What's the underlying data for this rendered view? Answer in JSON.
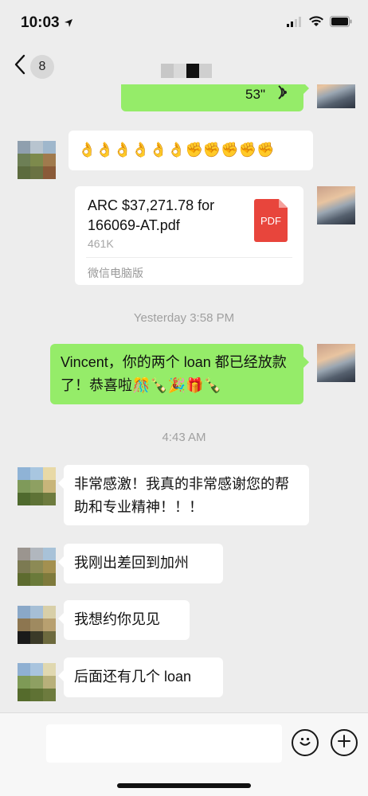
{
  "status_bar": {
    "time": "10:03",
    "location_icon": "location-arrow-icon",
    "signal_icon": "cellular-signal-icon",
    "wifi_icon": "wifi-icon",
    "battery_icon": "battery-icon"
  },
  "nav": {
    "back_icon": "chevron-left-icon",
    "unread_count": "8"
  },
  "messages": {
    "voice": {
      "duration": "53\"",
      "icon": "voice-wave-icon"
    },
    "emoji_row": {
      "text": "👌👌👌👌👌👌✊✊✊✊✊"
    },
    "file": {
      "name": "ARC $37,271.78 for 166069-AT.pdf",
      "size": "461K",
      "source": "微信电脑版",
      "badge": "PDF"
    },
    "time1": "Yesterday 3:58 PM",
    "sent_text": "Vincent，你的两个 loan 都已经放款了！恭喜啦🎊🍾🎉🎁🍾",
    "time2": "4:43 AM",
    "reply1": "非常感激！我真的非常感谢您的帮助和专业精神！！！",
    "reply2": "我刚出差回到加州",
    "reply3": "我想约你见见",
    "reply4": "后面还有几个 loan"
  },
  "input_bar": {
    "emoji_icon": "smiley-face-icon",
    "plus_icon": "plus-icon"
  },
  "colors": {
    "background": "#ededed",
    "sent_bubble": "#95ec69",
    "received_bubble": "#ffffff",
    "pdf_red": "#e8453c"
  }
}
